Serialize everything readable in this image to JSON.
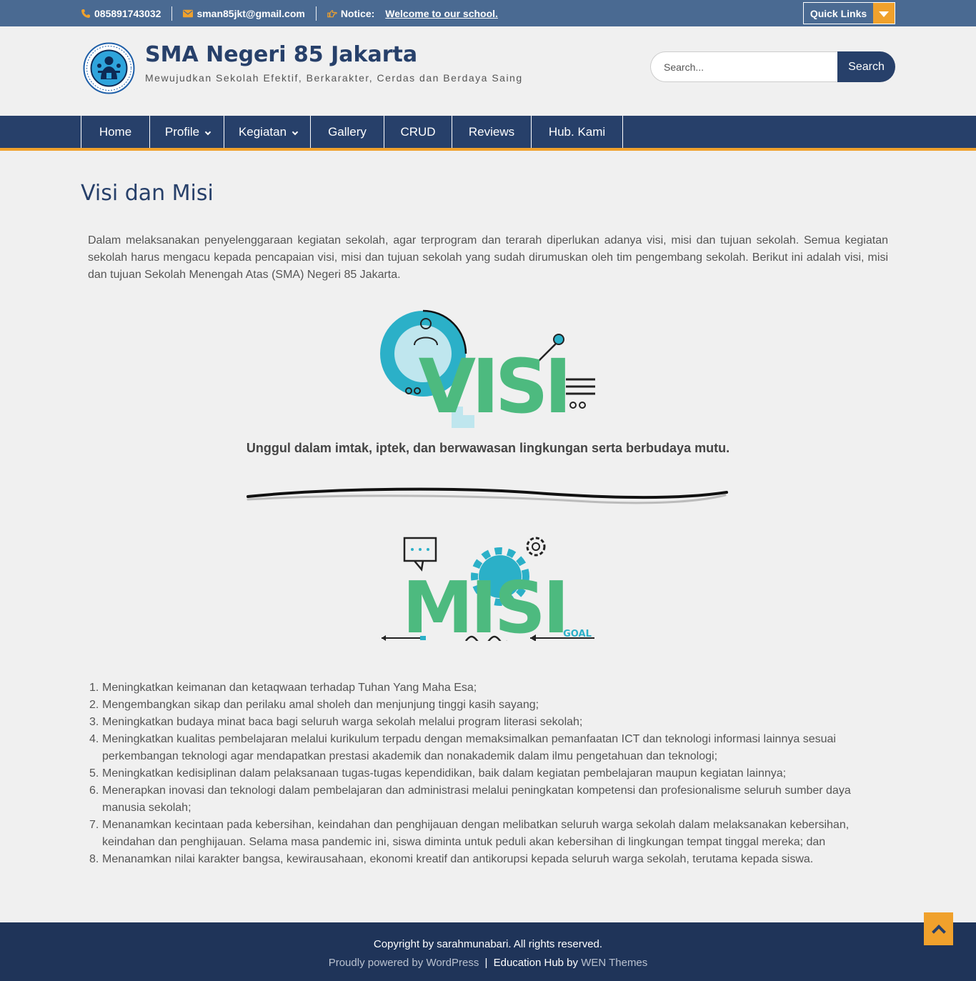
{
  "topbar": {
    "phone": "085891743032",
    "email": "sman85jkt@gmail.com",
    "notice_label": "Notice:",
    "notice_text": "Welcome to our school.",
    "quick_links_label": "Quick Links",
    "icons": [
      "phone-icon",
      "envelope-icon",
      "hand-pointing-icon",
      "caret-down-icon"
    ]
  },
  "header": {
    "site_title": "SMA Negeri 85 Jakarta",
    "site_description": "Mewujudkan Sekolah Efektif, Berkarakter, Cerdas dan Berdaya Saing",
    "search_placeholder": "Search...",
    "search_button": "Search"
  },
  "nav": {
    "items": [
      {
        "label": "Home",
        "has_submenu": false
      },
      {
        "label": "Profile",
        "has_submenu": true
      },
      {
        "label": "Kegiatan",
        "has_submenu": true
      },
      {
        "label": "Gallery",
        "has_submenu": false
      },
      {
        "label": "CRUD",
        "has_submenu": false
      },
      {
        "label": "Reviews",
        "has_submenu": false
      },
      {
        "label": "Hub. Kami",
        "has_submenu": false
      }
    ]
  },
  "content": {
    "page_title": "Visi dan Misi",
    "intro": "Dalam melaksanakan penyelenggaraan kegiatan sekolah, agar terprogram dan terarah diperlukan adanya visi, misi dan tujuan sekolah. Semua kegiatan sekolah harus mengacu kepada pencapaian visi, misi dan tujuan sekolah yang sudah dirumuskan oleh tim pengembang sekolah. Berikut ini adalah visi, misi dan tujuan Sekolah Menengah Atas (SMA) Negeri 85 Jakarta.",
    "visi_image_text": "VISI",
    "visi_statement": "Unggul dalam imtak, iptek, dan berwawasan lingkungan serta berbudaya mutu.",
    "misi_image_text": "MISI",
    "misi_image_subtext": "GOAL",
    "misi_items": [
      {
        "num": "1.",
        "text": "Meningkatkan keimanan dan ketaqwaan terhadap Tuhan Yang Maha Esa;"
      },
      {
        "num": "2.",
        "text": "Mengembangkan sikap dan perilaku amal sholeh dan menjunjung tinggi kasih sayang;"
      },
      {
        "num": "3.",
        "text": "Meningkatkan budaya minat baca bagi seluruh warga sekolah melalui program literasi sekolah;"
      },
      {
        "num": "4.",
        "text": "Meningkatkan kualitas pembelajaran melalui kurikulum terpadu dengan memaksimalkan pemanfaatan ICT dan teknologi informasi lainnya sesuai perkembangan teknologi agar mendapatkan prestasi akademik dan nonakademik dalam ilmu pengetahuan dan teknologi;"
      },
      {
        "num": "5.",
        "text": "Meningkatkan kedisiplinan dalam pelaksanaan tugas-tugas kependidikan, baik dalam kegiatan pembelajaran maupun kegiatan lainnya;"
      },
      {
        "num": "6.",
        "text": "Menerapkan inovasi dan teknologi dalam pembelajaran dan administrasi melalui peningkatan kompetensi dan profesionalisme seluruh sumber daya manusia sekolah;"
      },
      {
        "num": "7.",
        "text": "Menanamkan kecintaan pada kebersihan, keindahan dan penghijauan dengan melibatkan seluruh warga sekolah dalam melaksanakan kebersihan, keindahan dan penghijauan. Selama masa pandemic ini, siswa diminta untuk peduli akan kebersihan di lingkungan tempat tinggal mereka; dan"
      },
      {
        "num": "8.",
        "text": "Menanamkan nilai karakter bangsa, kewirausahaan, ekonomi kreatif dan antikorupsi kepada seluruh warga sekolah, terutama kepada siswa."
      }
    ]
  },
  "footer": {
    "copyright": "Copyright by sarahmunabari. All rights reserved.",
    "powered_by": "Proudly powered by WordPress",
    "separator": "|",
    "theme_prefix": "Education Hub by",
    "theme_author": "WEN Themes"
  },
  "colors": {
    "topbar_bg": "#4a6a92",
    "primary": "#27406a",
    "accent": "#f0a12c",
    "footer_bg": "#1f3459",
    "visi_green": "#4dba7f",
    "visi_cyan": "#2bb0c8"
  }
}
